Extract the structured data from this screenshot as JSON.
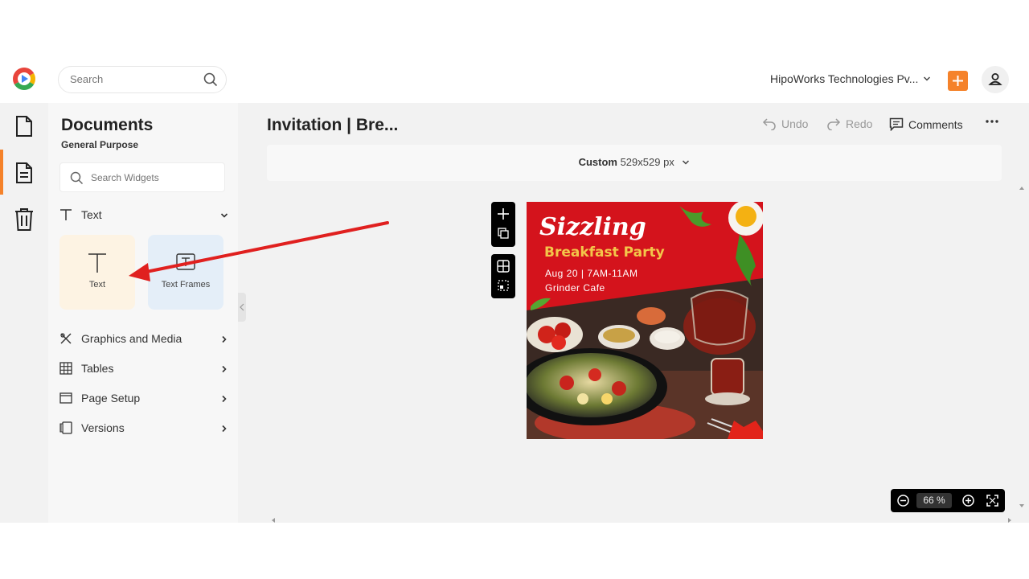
{
  "header": {
    "search_placeholder": "Search",
    "org_name": "HipoWorks Technologies Pv...",
    "accent_color": "#f5822a"
  },
  "rail": {
    "items": [
      {
        "icon": "document-icon"
      },
      {
        "icon": "form-icon",
        "active": true
      },
      {
        "icon": "trash-icon"
      }
    ]
  },
  "panel": {
    "title": "Documents",
    "subtitle": "General Purpose",
    "search_placeholder": "Search Widgets",
    "text_section": "Text",
    "tiles": [
      {
        "label": "Text",
        "color": "#fdf3e3"
      },
      {
        "label": "Text Frames",
        "color": "#e4eef8"
      }
    ],
    "sections": [
      {
        "label": "Graphics and Media",
        "icon": "graphics-icon"
      },
      {
        "label": "Tables",
        "icon": "table-icon"
      },
      {
        "label": "Page Setup",
        "icon": "page-setup-icon"
      },
      {
        "label": "Versions",
        "icon": "versions-icon"
      }
    ]
  },
  "editor": {
    "doc_title": "Invitation | Bre...",
    "undo": "Undo",
    "redo": "Redo",
    "comments": "Comments",
    "size_preset": "Custom",
    "size_value": "529x529 px",
    "zoom_value": "66",
    "zoom_unit": "%"
  },
  "artwork": {
    "title": "Sizzling",
    "subtitle": "Breakfast Party",
    "date_line": "Aug 20 | 7AM-11AM",
    "venue": "Grinder Cafe",
    "red": "#d4131c",
    "yellow": "#f3c64a"
  },
  "annotation": {
    "arrow_color": "#e0201f"
  }
}
